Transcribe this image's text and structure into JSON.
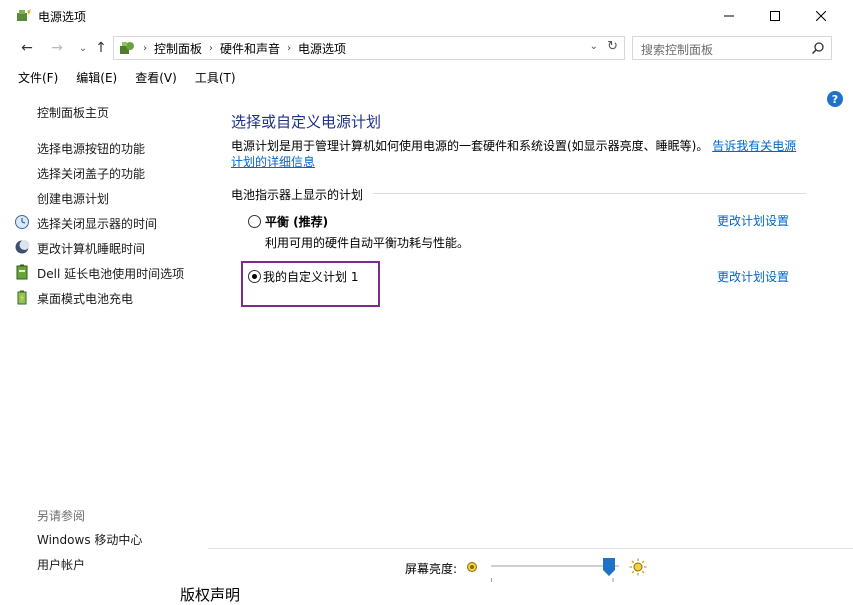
{
  "window": {
    "title": "电源选项",
    "controls": {
      "minimize": "—",
      "maximize": "☐",
      "close": "✕"
    }
  },
  "address_bar": {
    "breadcrumbs": [
      "控制面板",
      "硬件和声音",
      "电源选项"
    ],
    "search_placeholder": "搜索控制面板"
  },
  "menu": {
    "items": [
      "文件(F)",
      "编辑(E)",
      "查看(V)",
      "工具(T)"
    ]
  },
  "sidebar": {
    "home": "控制面板主页",
    "links": [
      "选择电源按钮的功能",
      "选择关闭盖子的功能",
      "创建电源计划",
      "选择关闭显示器的时间",
      "更改计算机睡眠时间",
      "Dell 延长电池使用时间选项",
      "桌面模式电池充电"
    ],
    "see_also_label": "另请参阅",
    "see_also": [
      "Windows 移动中心",
      "用户帐户"
    ]
  },
  "main": {
    "title": "选择或自定义电源计划",
    "description": "电源计划是用于管理计算机如何使用电源的一套硬件和系统设置(如显示器亮度、睡眠等)。",
    "description_link": "告诉我有关电源计划的详细信息",
    "group_label": "电池指示器上显示的计划",
    "plans": [
      {
        "name": "平衡 (推荐)",
        "description": "利用可用的硬件自动平衡功耗与性能。",
        "selected": false,
        "change_link": "更改计划设置"
      },
      {
        "name": "我的自定义计划 1",
        "description": "",
        "selected": true,
        "change_link": "更改计划设置"
      }
    ]
  },
  "footer": {
    "brightness_label": "屏幕亮度:",
    "brightness_level": 0.92
  },
  "colors": {
    "title_blue": "#1e3287",
    "link_blue": "#0066cc",
    "highlight": "#7b2c8c",
    "slider_thumb": "#1e73c8"
  },
  "bottom_fragment": "版权声明"
}
